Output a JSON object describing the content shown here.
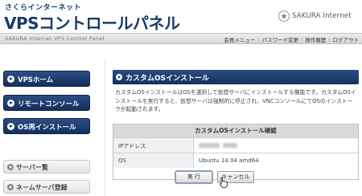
{
  "header": {
    "subtitle": "さくらインターネット",
    "title": "VPSコントロールパネル",
    "logo_text": "SAKURA Internet",
    "caption": "SAKURA Internet VPS Control Panel",
    "links": [
      "会員メニュー",
      "パスワード変更",
      "操作履歴",
      "ログアウト"
    ]
  },
  "sidebar": {
    "primary": [
      "VPSホーム",
      "リモートコンソール",
      "OS再インストール"
    ],
    "secondary": [
      "サーバー覧",
      "ネームサーバ登録"
    ]
  },
  "main": {
    "title": "カスタムOSインストール",
    "description": "カスタムOSインストールはOSを選択して仮想サーバにインストールする機能です。カスタムOSインストールを実行すると、仮想サーバは強制的に停止され、VNCコンソールにてOSのインストーラが起動されます。",
    "confirm_title": "カスタムOSインストール確認",
    "ip_label": "IPアドレス",
    "os_label": "OS",
    "os_value": "Ubuntu 14.04 amd64",
    "execute_label": "実 行",
    "cancel_label": "キャンセル"
  },
  "colors": {
    "brand_navy": "#1b3a6b",
    "sidebar_button": "#12305d",
    "table_head": "#d9d9d9"
  }
}
